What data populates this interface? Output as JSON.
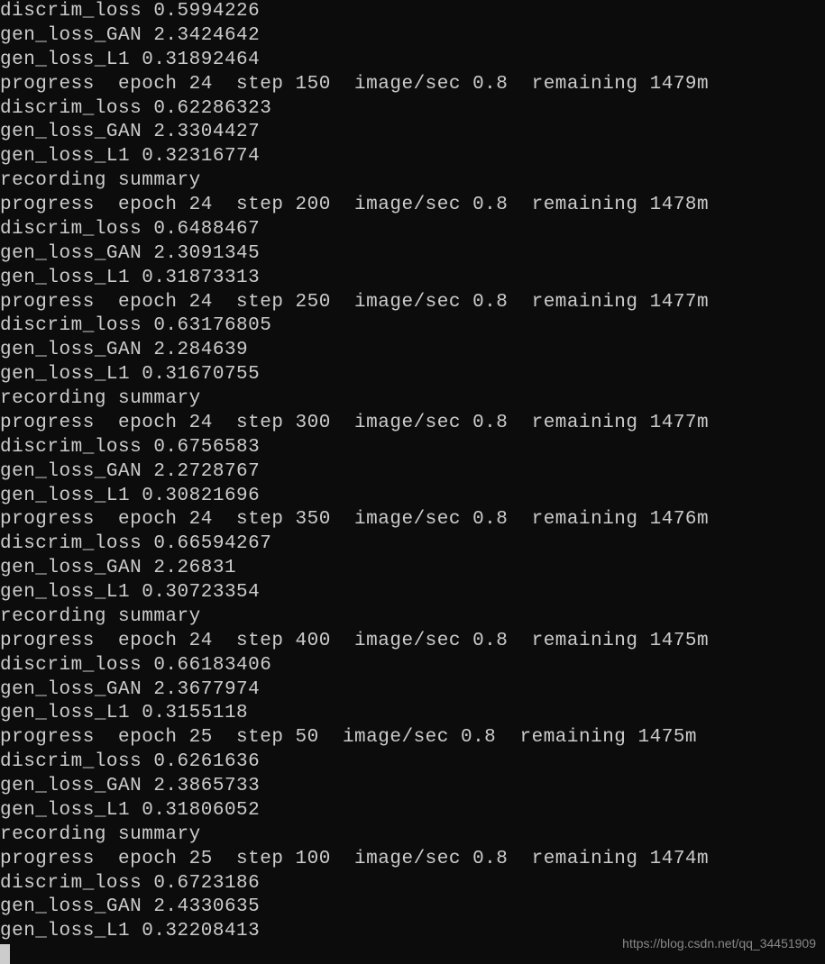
{
  "lines": [
    "discrim_loss 0.5994226",
    "gen_loss_GAN 2.3424642",
    "gen_loss_L1 0.31892464",
    "progress  epoch 24  step 150  image/sec 0.8  remaining 1479m",
    "discrim_loss 0.62286323",
    "gen_loss_GAN 2.3304427",
    "gen_loss_L1 0.32316774",
    "recording summary",
    "progress  epoch 24  step 200  image/sec 0.8  remaining 1478m",
    "discrim_loss 0.6488467",
    "gen_loss_GAN 2.3091345",
    "gen_loss_L1 0.31873313",
    "progress  epoch 24  step 250  image/sec 0.8  remaining 1477m",
    "discrim_loss 0.63176805",
    "gen_loss_GAN 2.284639",
    "gen_loss_L1 0.31670755",
    "recording summary",
    "progress  epoch 24  step 300  image/sec 0.8  remaining 1477m",
    "discrim_loss 0.6756583",
    "gen_loss_GAN 2.2728767",
    "gen_loss_L1 0.30821696",
    "progress  epoch 24  step 350  image/sec 0.8  remaining 1476m",
    "discrim_loss 0.66594267",
    "gen_loss_GAN 2.26831",
    "gen_loss_L1 0.30723354",
    "recording summary",
    "progress  epoch 24  step 400  image/sec 0.8  remaining 1475m",
    "discrim_loss 0.66183406",
    "gen_loss_GAN 2.3677974",
    "gen_loss_L1 0.3155118",
    "progress  epoch 25  step 50  image/sec 0.8  remaining 1475m",
    "discrim_loss 0.6261636",
    "gen_loss_GAN 2.3865733",
    "gen_loss_L1 0.31806052",
    "recording summary",
    "progress  epoch 25  step 100  image/sec 0.8  remaining 1474m",
    "discrim_loss 0.6723186",
    "gen_loss_GAN 2.4330635",
    "gen_loss_L1 0.32208413"
  ],
  "watermark": "https://blog.csdn.net/qq_34451909"
}
